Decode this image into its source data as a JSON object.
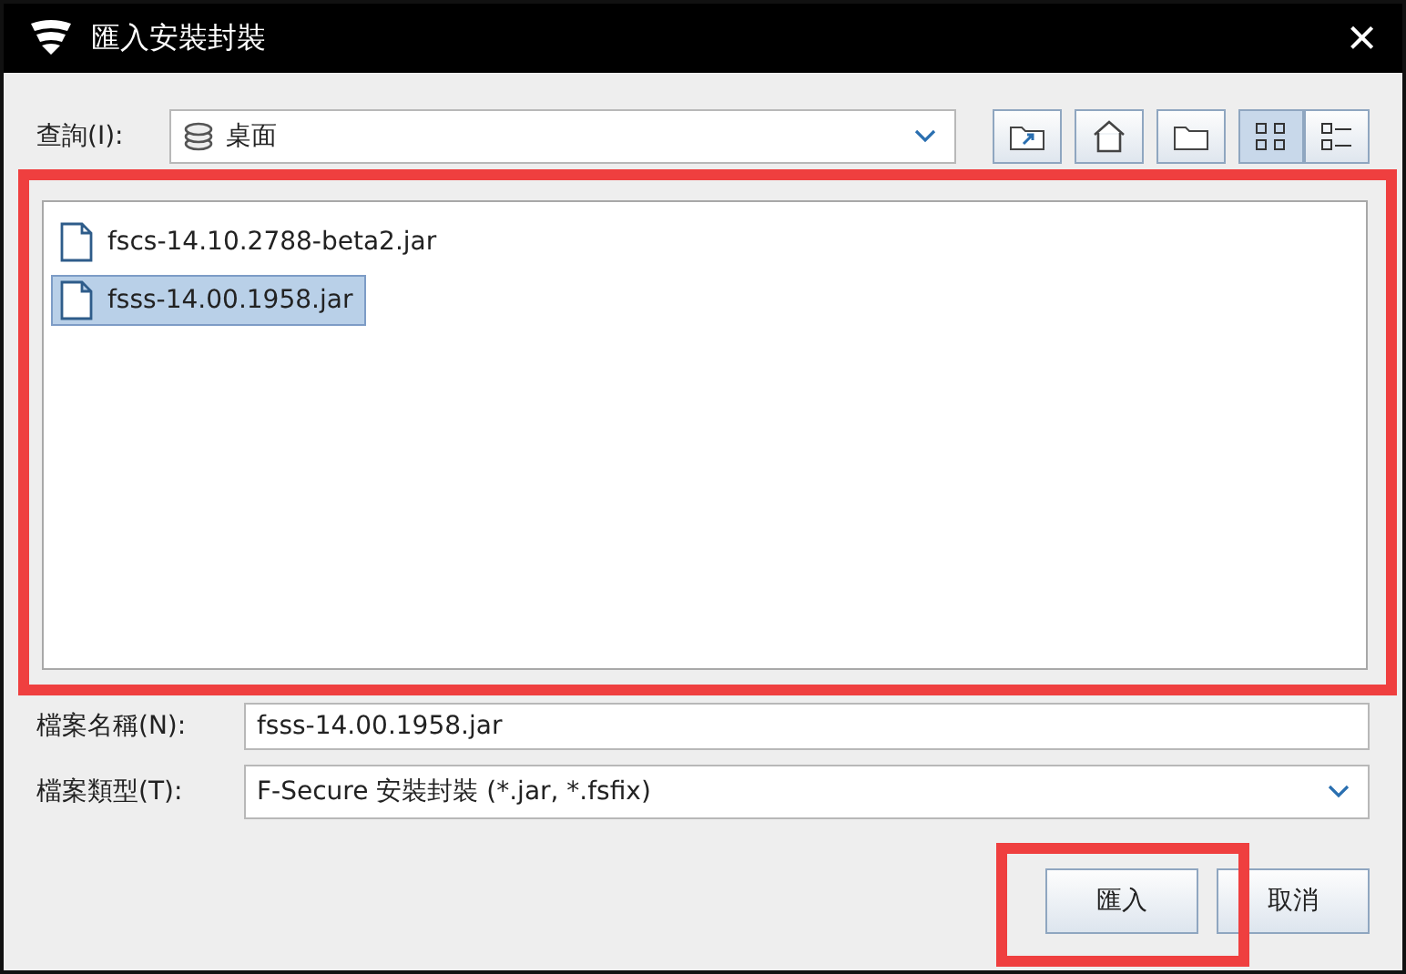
{
  "window": {
    "title": "匯入安裝封裝",
    "close": "×"
  },
  "look_in": {
    "label": "查詢(I):",
    "value": "桌面"
  },
  "files": [
    {
      "name": "fscs-14.10.2788-beta2.jar",
      "selected": false
    },
    {
      "name": "fsss-14.00.1958.jar",
      "selected": true
    }
  ],
  "file_name": {
    "label": "檔案名稱(N):",
    "value": "fsss-14.00.1958.jar"
  },
  "file_type": {
    "label": "檔案類型(T):",
    "value": "F-Secure 安裝封裝 (*.jar, *.fsfix)"
  },
  "view_toggle": {
    "list_selected": true
  },
  "buttons": [
    {
      "label": "匯入",
      "highlighted": true
    },
    {
      "label": "取消",
      "highlighted": false
    }
  ]
}
